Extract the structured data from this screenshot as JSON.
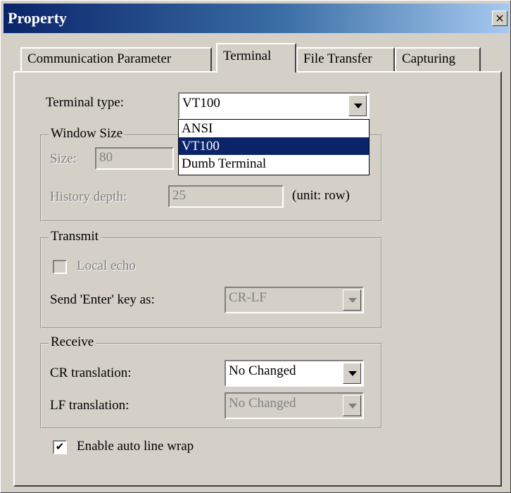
{
  "window": {
    "title": "Property",
    "close_glyph": "×"
  },
  "tabs": [
    {
      "label": "Communication Parameter",
      "active": false
    },
    {
      "label": "Terminal",
      "active": true
    },
    {
      "label": "File Transfer",
      "active": false
    },
    {
      "label": "Capturing",
      "active": false
    }
  ],
  "terminal_type": {
    "label": "Terminal type:",
    "value": "VT100",
    "options": [
      "ANSI",
      "VT100",
      "Dumb Terminal"
    ],
    "selected_option": "VT100"
  },
  "window_size": {
    "title": "Window Size",
    "size_label": "Size:",
    "size_value": "80",
    "history_label": "History depth:",
    "history_value": "25",
    "unit_label": "(unit: row)"
  },
  "transmit": {
    "title": "Transmit",
    "local_echo_label": "Local echo",
    "local_echo_checked": false,
    "send_enter_label": "Send 'Enter' key  as:",
    "send_enter_value": "CR-LF"
  },
  "receive": {
    "title": "Receive",
    "cr_label": "CR translation:",
    "cr_value": "No Changed",
    "lf_label": "LF translation:",
    "lf_value": "No Changed"
  },
  "auto_wrap": {
    "label": "Enable auto line wrap",
    "checked": true,
    "check_glyph": "✔"
  },
  "colors": {
    "titlebar_start": "#0a246a",
    "titlebar_end": "#a6caf0",
    "face": "#d4d0c8",
    "selection": "#0a246a"
  }
}
